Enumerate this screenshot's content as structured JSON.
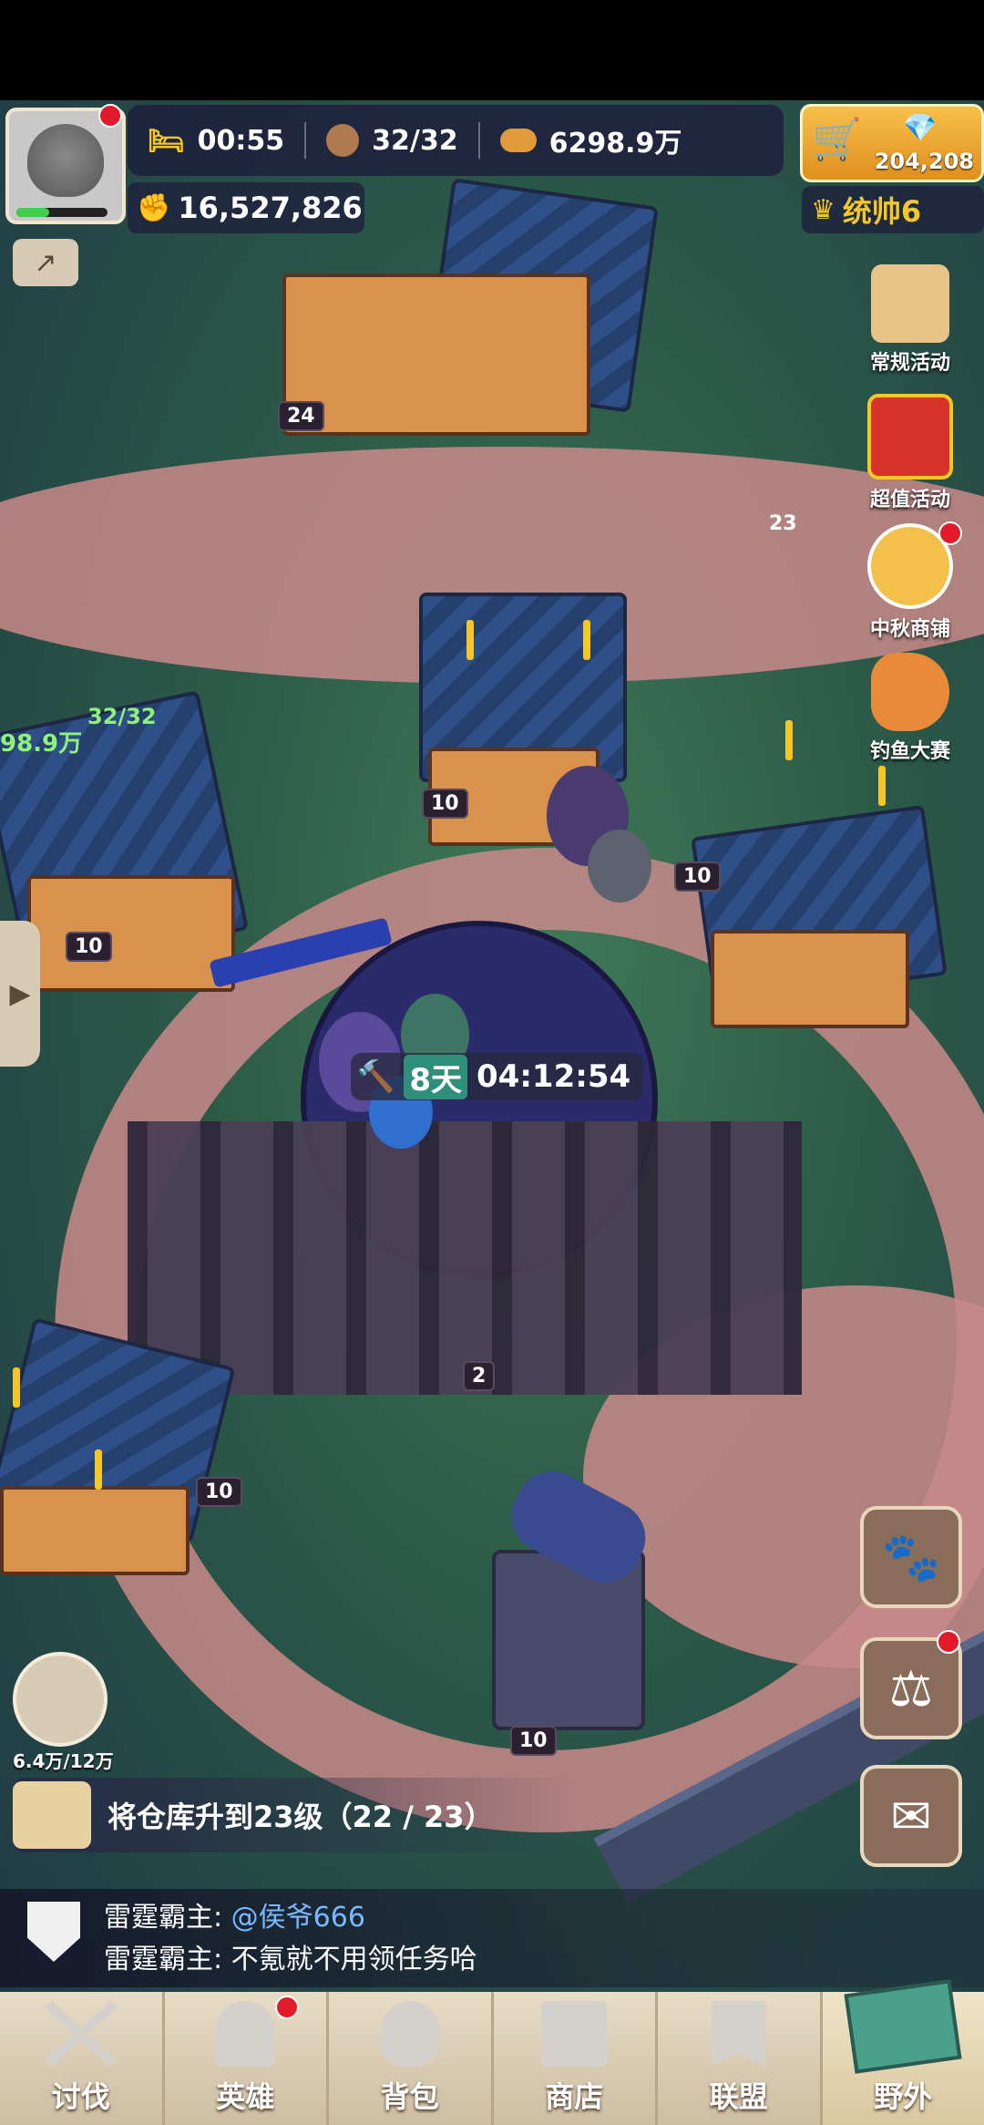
{
  "status": {
    "sleep_timer": "00:55",
    "population": "32/32",
    "food": "6298.9万",
    "gems": "204,208",
    "power": "16,527,826",
    "commander_label": "统帅6"
  },
  "side_menu": {
    "regular_event": "常规活动",
    "value_event": "超值活动",
    "mid_autumn_shop": "中秋商铺",
    "fishing_contest": "钓鱼大赛",
    "mail_badge": "23"
  },
  "map": {
    "building_timer_days": "8天",
    "building_timer_time": "04:12:54",
    "left_building_food": "98.9万",
    "left_building_pop": "32/32",
    "levels": [
      "24",
      "10",
      "10",
      "10",
      "10",
      "10",
      "2",
      "10"
    ],
    "workers": "6.4万/12万"
  },
  "quest": {
    "text": "将仓库升到23级（22 / 23）"
  },
  "chat": {
    "line1_sender": "雷霆霸主:",
    "line1_text": "@侯爷666",
    "line2_sender": "雷霆霸主:",
    "line2_text": "不氪就不用领任务哈"
  },
  "nav": {
    "items": [
      "讨伐",
      "英雄",
      "背包",
      "商店",
      "联盟",
      "野外"
    ]
  },
  "colors": {
    "accent_gold": "#f3c728",
    "notification_red": "#e21a2a",
    "grass": "#3f7a58",
    "path": "#c98a8a"
  }
}
